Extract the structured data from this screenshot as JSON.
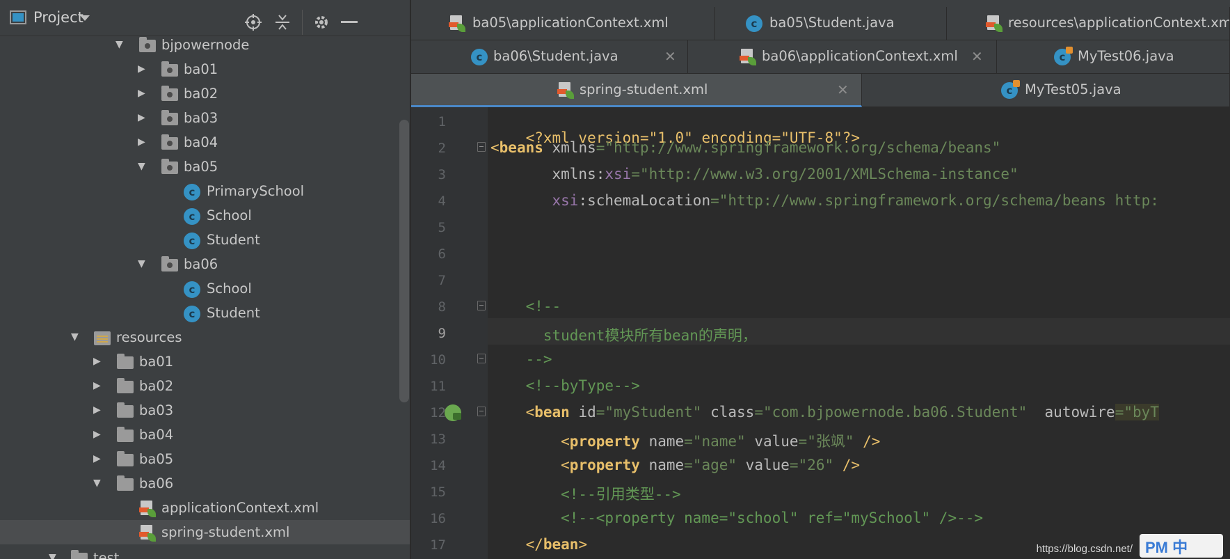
{
  "project_panel": {
    "title": "Project",
    "tree": [
      {
        "label": "bjpowernode",
        "kind": "package",
        "expanded": true
      },
      {
        "label": "ba01",
        "kind": "package",
        "expanded": false
      },
      {
        "label": "ba02",
        "kind": "package",
        "expanded": false
      },
      {
        "label": "ba03",
        "kind": "package",
        "expanded": false
      },
      {
        "label": "ba04",
        "kind": "package",
        "expanded": false
      },
      {
        "label": "ba05",
        "kind": "package",
        "expanded": true
      },
      {
        "label": "PrimarySchool",
        "kind": "class"
      },
      {
        "label": "School",
        "kind": "class"
      },
      {
        "label": "Student",
        "kind": "class"
      },
      {
        "label": "ba06",
        "kind": "package",
        "expanded": true
      },
      {
        "label": "School",
        "kind": "class"
      },
      {
        "label": "Student",
        "kind": "class"
      },
      {
        "label": "resources",
        "kind": "resources",
        "expanded": true
      },
      {
        "label": "ba01",
        "kind": "folder",
        "expanded": false
      },
      {
        "label": "ba02",
        "kind": "folder",
        "expanded": false
      },
      {
        "label": "ba03",
        "kind": "folder",
        "expanded": false
      },
      {
        "label": "ba04",
        "kind": "folder",
        "expanded": false
      },
      {
        "label": "ba05",
        "kind": "folder",
        "expanded": false
      },
      {
        "label": "ba06",
        "kind": "folder",
        "expanded": true
      },
      {
        "label": "applicationContext.xml",
        "kind": "xml"
      },
      {
        "label": "spring-student.xml",
        "kind": "xml",
        "selected": true
      },
      {
        "label": "test",
        "kind": "folder",
        "expanded": true
      }
    ]
  },
  "tabs": {
    "row1": [
      "ba05\\applicationContext.xml",
      "ba05\\Student.java",
      "resources\\applicationContext.xml"
    ],
    "row2": [
      "ba06\\Student.java",
      "ba06\\applicationContext.xml",
      "MyTest06.java"
    ],
    "row3": [
      "spring-student.xml",
      "MyTest05.java"
    ],
    "close_glyph": "✕"
  },
  "editor": {
    "line_numbers": [
      "1",
      "2",
      "3",
      "4",
      "5",
      "6",
      "7",
      "8",
      "9",
      "10",
      "11",
      "12",
      "13",
      "14",
      "15",
      "16",
      "17"
    ],
    "current_line": "9",
    "lines": {
      "l1": {
        "a": "<?xml version=\"1.0\" encoding=\"UTF-8\"?>"
      },
      "l2": {
        "a": "<",
        "b": "beans",
        "c": " xmlns",
        "d": "=\"http://www.springframework.org/schema/beans\""
      },
      "l3": {
        "a": "       xmlns:",
        "b": "xsi",
        "c": "=\"http://www.w3.org/2001/XMLSchema-instance\""
      },
      "l4": {
        "a": "       xsi",
        "b": ":schemaLocation",
        "c": "=\"http://www.springframework.org/schema/beans http:"
      },
      "l8": {
        "a": "    <!--"
      },
      "l9": {
        "a": "      student模块所有bean的声明，"
      },
      "l10": {
        "a": "    -->"
      },
      "l11": {
        "a": "    <!--byType-->"
      },
      "l12": {
        "a": "    <",
        "b": "bean",
        "c": " id",
        "d": "=\"myStudent\"",
        "e": " class",
        "f": "=\"com.bjpowernode.ba06.Student\"",
        "g": "  autowire",
        "h": "=\"byT"
      },
      "l13": {
        "a": "        <",
        "b": "property",
        "c": " name",
        "d": "=\"name\"",
        "e": " value",
        "f": "=\"张飒\"",
        "g": " />"
      },
      "l14": {
        "a": "        <",
        "b": "property",
        "c": " name",
        "d": "=\"age\"",
        "e": " value",
        "f": "=\"26\"",
        "g": " />"
      },
      "l15": {
        "a": "        <!--引用类型-->"
      },
      "l16": {
        "a": "        <!--<property name=\"school\" ref=\"mySchool\" />-->"
      },
      "l17": {
        "a": "    </",
        "b": "bean",
        "c": ">"
      }
    }
  },
  "watermark": {
    "url": "https://blog.csdn.net/",
    "logo_text": "PM 中"
  }
}
